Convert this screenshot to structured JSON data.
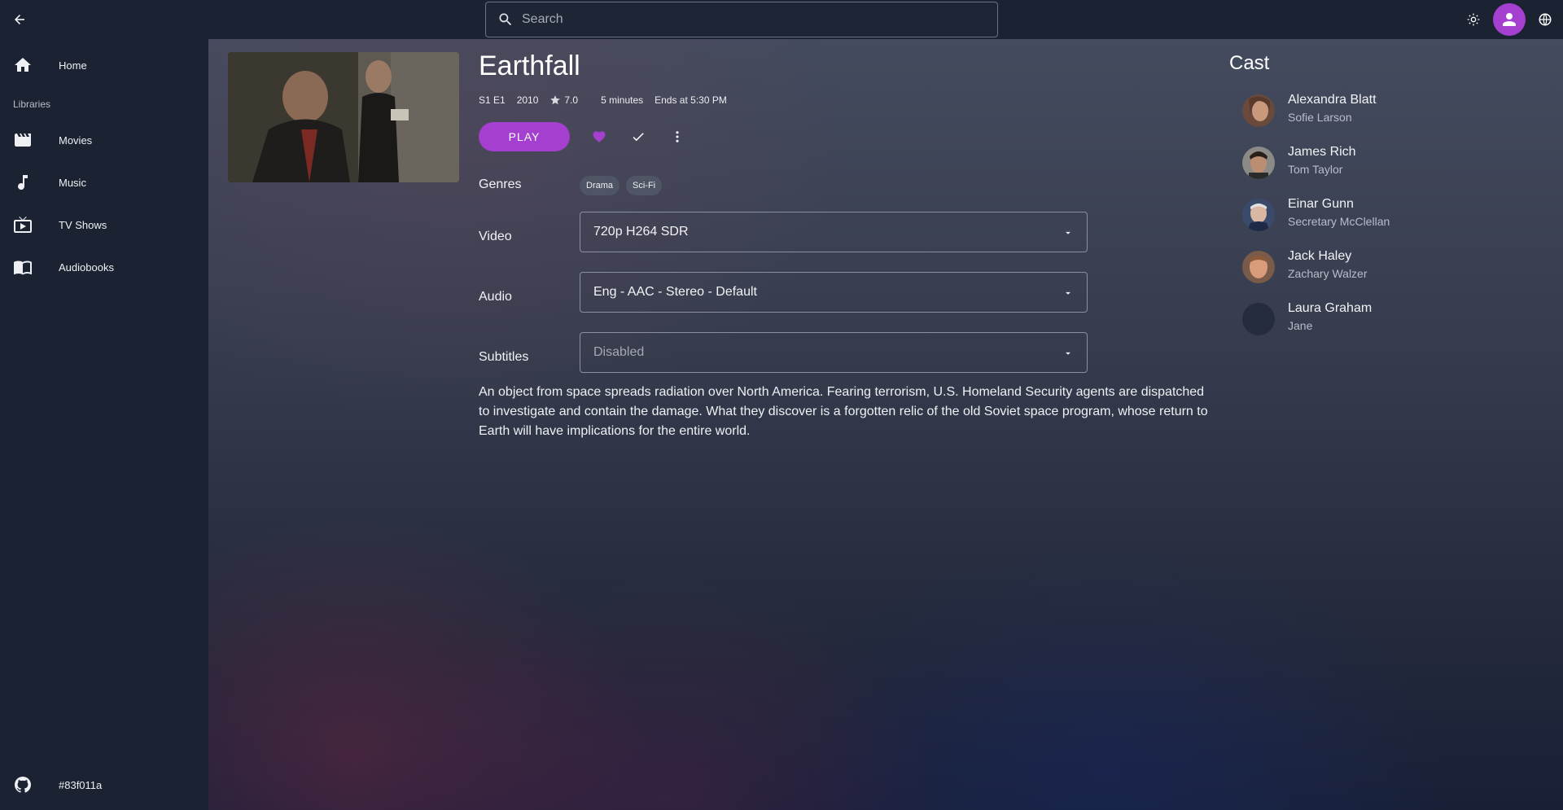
{
  "search": {
    "placeholder": "Search"
  },
  "sidebar": {
    "home": "Home",
    "libraries_heading": "Libraries",
    "items": [
      {
        "label": "Movies",
        "icon": "movie-icon"
      },
      {
        "label": "Music",
        "icon": "music-note-icon"
      },
      {
        "label": "TV Shows",
        "icon": "tv-icon"
      },
      {
        "label": "Audiobooks",
        "icon": "book-icon"
      }
    ],
    "footer": {
      "label": "#83f011a",
      "icon": "github-icon"
    }
  },
  "item": {
    "title": "Earthfall",
    "episode": "S1 E1",
    "year": "2010",
    "rating": "7.0",
    "runtime": "5 minutes",
    "ends_at": "Ends at 5:30 PM",
    "play_label": "PLAY",
    "genres_label": "Genres",
    "genres": [
      "Drama",
      "Sci-Fi"
    ],
    "video_label": "Video",
    "video_value": "720p H264 SDR",
    "audio_label": "Audio",
    "audio_value": "Eng - AAC - Stereo - Default",
    "subtitles_label": "Subtitles",
    "subtitles_value": "Disabled",
    "overview": "An object from space spreads radiation over North America. Fearing terrorism, U.S. Homeland Security agents are dispatched to investigate and contain the damage. What they discover is a forgotten relic of the old Soviet space program, whose return to Earth will have implications for the entire world."
  },
  "cast": {
    "title": "Cast",
    "people": [
      {
        "name": "Alexandra Blatt",
        "role": "Sofie Larson"
      },
      {
        "name": "James Rich",
        "role": "Tom Taylor"
      },
      {
        "name": "Einar Gunn",
        "role": "Secretary McClellan"
      },
      {
        "name": "Jack Haley",
        "role": "Zachary Walzer"
      },
      {
        "name": "Laura Graham",
        "role": "Jane"
      }
    ]
  },
  "colors": {
    "accent": "#a43fd0",
    "sidebar_bg": "#1b2231",
    "favorite": "#a43fd0"
  }
}
